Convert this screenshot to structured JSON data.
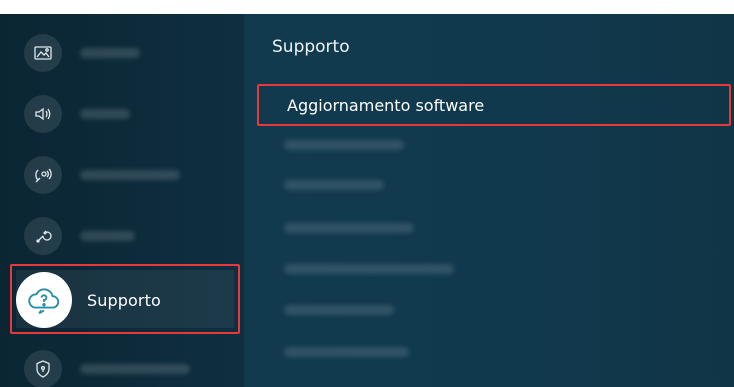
{
  "sidebar": {
    "selected_label": "Supporto",
    "items": [
      {
        "icon": "picture-icon"
      },
      {
        "icon": "sound-icon"
      },
      {
        "icon": "broadcast-icon"
      },
      {
        "icon": "wrench-icon"
      },
      {
        "icon": "support-cloud-icon",
        "label": "Supporto"
      },
      {
        "icon": "shield-icon"
      }
    ]
  },
  "main": {
    "section_title": "Supporto",
    "selected_item": "Aggiornamento software"
  },
  "colors": {
    "highlight_border": "#e8383a",
    "background": "#103346",
    "accent_teal": "#2a8fa8"
  }
}
